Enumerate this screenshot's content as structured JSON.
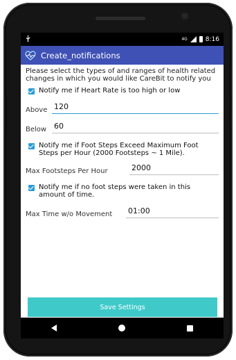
{
  "status_bar": {
    "left_icon": "usb-icon",
    "network": "4G",
    "time": "8:16"
  },
  "app_bar": {
    "title": "Create_notifications",
    "icon": "heart-pulse-icon"
  },
  "intro_text": "Please select the types of and ranges of health related changes in which you would like CareBit to notify you",
  "heart_rate": {
    "checkbox_label": "Notify me if Heart Rate is too high or low",
    "checked": true,
    "above_label": "Above",
    "above_value": "120",
    "below_label": "Below",
    "below_value": "60"
  },
  "foot_steps": {
    "checkbox_label": "Notify me if Foot Steps Exceed Maximum Foot Steps per Hour (2000 Footsteps ~ 1 Mile).",
    "checked": true,
    "max_label": "Max Footsteps Per Hour",
    "max_value": "2000"
  },
  "no_movement": {
    "checkbox_label": "Notify me if no foot steps were taken in this amount of time.",
    "checked": true,
    "max_label": "Max Time w/o Movement",
    "max_value": "01:00"
  },
  "save_button": {
    "label": "Save Settings"
  },
  "nav_bar": {
    "back": "back-icon",
    "home": "home-icon",
    "recents": "recents-icon"
  },
  "colors": {
    "app_bar": "#3f51b5",
    "accent": "#2b9dd4",
    "button": "#3fcac9"
  }
}
